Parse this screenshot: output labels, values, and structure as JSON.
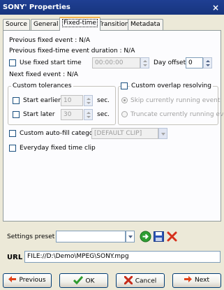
{
  "window": {
    "title": "SONY' Properties",
    "close_glyph": "×"
  },
  "tabs": [
    {
      "label": "Source",
      "active": false
    },
    {
      "label": "General",
      "active": false
    },
    {
      "label": "Fixed-time",
      "active": true
    },
    {
      "label": "Transition",
      "active": false
    },
    {
      "label": "Metadata",
      "active": false
    }
  ],
  "fixed_time": {
    "previous_event": "Previous fixed event : N/A",
    "previous_duration": "Previous fixed-time event duration : N/A",
    "use_fixed_start_label": "Use fixed start time",
    "use_fixed_start_checked": false,
    "start_time_value": "00:00:00",
    "day_offset_label": "Day offset",
    "day_offset_value": "0",
    "next_event": "Next fixed event : N/A"
  },
  "custom_tolerances": {
    "legend": "Custom tolerances",
    "start_earlier_label": "Start earlier",
    "start_earlier_checked": false,
    "start_earlier_value": "10",
    "start_later_label": "Start later",
    "start_later_checked": false,
    "start_later_value": "30",
    "unit": "sec."
  },
  "overlap": {
    "legend": "Custom overlap resolving",
    "checked": false,
    "option_skip": "Skip currently running event",
    "option_truncate": "Truncate currently running event",
    "selected": "skip"
  },
  "autofill": {
    "label": "Custom auto-fill category",
    "checked": false,
    "value": "[DEFAULT CLIP]"
  },
  "everyday": {
    "label": "Everyday fixed time clip",
    "checked": false
  },
  "settings_preset": {
    "label": "Settings preset",
    "value": ""
  },
  "url": {
    "label": "URL",
    "value": "FILE://D:\\Demo\\MPEG\\SONY.mpg"
  },
  "buttons": {
    "previous": "Previous",
    "ok": "OK",
    "cancel": "Cancel",
    "next": "Next"
  },
  "colors": {
    "titlebar": "#17357e",
    "ok_check": "#2e9b2e",
    "cancel_x": "#c62b1a",
    "arrow": "#e0431a",
    "apply_green": "#2f9e33",
    "save_blue": "#2d55b5"
  },
  "icons": {
    "apply": "green-circle-arrow-icon",
    "save": "floppy-disk-icon",
    "delete": "red-x-icon",
    "previous": "left-arrow-icon",
    "next": "right-arrow-icon",
    "ok": "checkmark-icon",
    "cancel": "x-icon"
  }
}
